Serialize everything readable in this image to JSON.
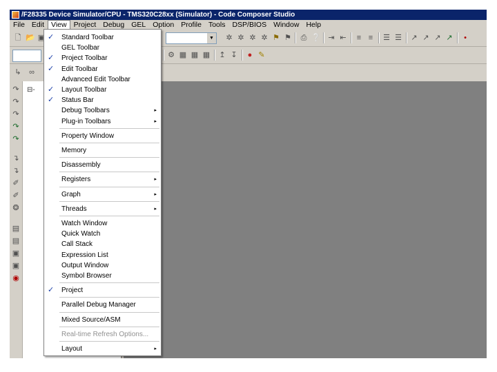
{
  "window": {
    "title": "/F28335 Device Simulator/CPU - TMS320C28xx (Simulator) - Code Composer Studio"
  },
  "menubar": [
    "File",
    "Edit",
    "View",
    "Project",
    "Debug",
    "GEL",
    "Option",
    "Profile",
    "Tools",
    "DSP/BIOS",
    "Window",
    "Help"
  ],
  "menubar_active": "View",
  "tree": {
    "row1": "",
    "row2": "⊟-"
  },
  "view_menu": {
    "items": [
      {
        "label": "Standard Toolbar",
        "checked": true,
        "submenu": false,
        "enabled": true
      },
      {
        "label": "GEL Toolbar",
        "checked": false,
        "submenu": false,
        "enabled": true
      },
      {
        "label": "Project Toolbar",
        "checked": true,
        "submenu": false,
        "enabled": true
      },
      {
        "label": "Edit Toolbar",
        "checked": true,
        "submenu": false,
        "enabled": true
      },
      {
        "label": "Advanced Edit Toolbar",
        "checked": false,
        "submenu": false,
        "enabled": true
      },
      {
        "label": "Layout Toolbar",
        "checked": true,
        "submenu": false,
        "enabled": true
      },
      {
        "label": "Status Bar",
        "checked": true,
        "submenu": false,
        "enabled": true
      },
      {
        "label": "Debug Toolbars",
        "checked": false,
        "submenu": true,
        "enabled": true
      },
      {
        "label": "Plug-in Toolbars",
        "checked": false,
        "submenu": true,
        "enabled": true
      },
      {
        "label": "Property Window",
        "checked": false,
        "submenu": false,
        "enabled": true
      },
      {
        "label": "Memory",
        "checked": false,
        "submenu": false,
        "enabled": true
      },
      {
        "label": "Disassembly",
        "checked": false,
        "submenu": false,
        "enabled": true
      },
      {
        "label": "Registers",
        "checked": false,
        "submenu": true,
        "enabled": true
      },
      {
        "label": "Graph",
        "checked": false,
        "submenu": true,
        "enabled": true
      },
      {
        "label": "Threads",
        "checked": false,
        "submenu": true,
        "enabled": true
      },
      {
        "label": "Watch Window",
        "checked": false,
        "submenu": false,
        "enabled": true
      },
      {
        "label": "Quick Watch",
        "checked": false,
        "submenu": false,
        "enabled": true
      },
      {
        "label": "Call Stack",
        "checked": false,
        "submenu": false,
        "enabled": true
      },
      {
        "label": "Expression List",
        "checked": false,
        "submenu": false,
        "enabled": true
      },
      {
        "label": "Output Window",
        "checked": false,
        "submenu": false,
        "enabled": true
      },
      {
        "label": "Symbol Browser",
        "checked": false,
        "submenu": false,
        "enabled": true
      },
      {
        "label": "Project",
        "checked": true,
        "submenu": false,
        "enabled": true
      },
      {
        "label": "Parallel Debug Manager",
        "checked": false,
        "submenu": false,
        "enabled": true
      },
      {
        "label": "Mixed Source/ASM",
        "checked": false,
        "submenu": false,
        "enabled": true
      },
      {
        "label": "Real-time Refresh Options...",
        "checked": false,
        "submenu": false,
        "enabled": false
      },
      {
        "label": "Layout",
        "checked": false,
        "submenu": true,
        "enabled": true
      }
    ]
  },
  "icons": {
    "check": "✓",
    "submenu_arrow": "▸",
    "dropdown_arrow": "▼"
  }
}
